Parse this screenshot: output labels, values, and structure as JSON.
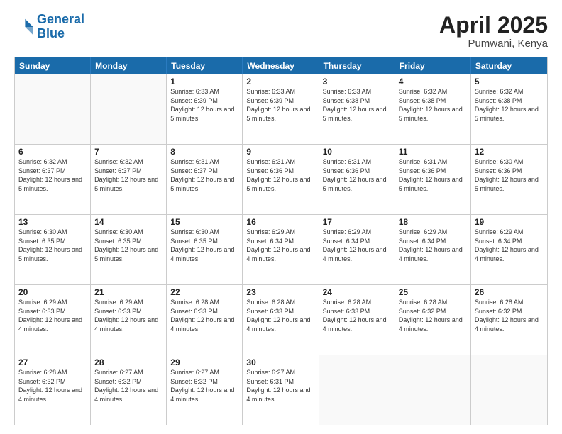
{
  "header": {
    "logo_line1": "General",
    "logo_line2": "Blue",
    "month": "April 2025",
    "location": "Pumwani, Kenya"
  },
  "days_of_week": [
    "Sunday",
    "Monday",
    "Tuesday",
    "Wednesday",
    "Thursday",
    "Friday",
    "Saturday"
  ],
  "weeks": [
    [
      {
        "day": "",
        "info": ""
      },
      {
        "day": "",
        "info": ""
      },
      {
        "day": "1",
        "info": "Sunrise: 6:33 AM\nSunset: 6:39 PM\nDaylight: 12 hours and 5 minutes."
      },
      {
        "day": "2",
        "info": "Sunrise: 6:33 AM\nSunset: 6:39 PM\nDaylight: 12 hours and 5 minutes."
      },
      {
        "day": "3",
        "info": "Sunrise: 6:33 AM\nSunset: 6:38 PM\nDaylight: 12 hours and 5 minutes."
      },
      {
        "day": "4",
        "info": "Sunrise: 6:32 AM\nSunset: 6:38 PM\nDaylight: 12 hours and 5 minutes."
      },
      {
        "day": "5",
        "info": "Sunrise: 6:32 AM\nSunset: 6:38 PM\nDaylight: 12 hours and 5 minutes."
      }
    ],
    [
      {
        "day": "6",
        "info": "Sunrise: 6:32 AM\nSunset: 6:37 PM\nDaylight: 12 hours and 5 minutes."
      },
      {
        "day": "7",
        "info": "Sunrise: 6:32 AM\nSunset: 6:37 PM\nDaylight: 12 hours and 5 minutes."
      },
      {
        "day": "8",
        "info": "Sunrise: 6:31 AM\nSunset: 6:37 PM\nDaylight: 12 hours and 5 minutes."
      },
      {
        "day": "9",
        "info": "Sunrise: 6:31 AM\nSunset: 6:36 PM\nDaylight: 12 hours and 5 minutes."
      },
      {
        "day": "10",
        "info": "Sunrise: 6:31 AM\nSunset: 6:36 PM\nDaylight: 12 hours and 5 minutes."
      },
      {
        "day": "11",
        "info": "Sunrise: 6:31 AM\nSunset: 6:36 PM\nDaylight: 12 hours and 5 minutes."
      },
      {
        "day": "12",
        "info": "Sunrise: 6:30 AM\nSunset: 6:36 PM\nDaylight: 12 hours and 5 minutes."
      }
    ],
    [
      {
        "day": "13",
        "info": "Sunrise: 6:30 AM\nSunset: 6:35 PM\nDaylight: 12 hours and 5 minutes."
      },
      {
        "day": "14",
        "info": "Sunrise: 6:30 AM\nSunset: 6:35 PM\nDaylight: 12 hours and 5 minutes."
      },
      {
        "day": "15",
        "info": "Sunrise: 6:30 AM\nSunset: 6:35 PM\nDaylight: 12 hours and 4 minutes."
      },
      {
        "day": "16",
        "info": "Sunrise: 6:29 AM\nSunset: 6:34 PM\nDaylight: 12 hours and 4 minutes."
      },
      {
        "day": "17",
        "info": "Sunrise: 6:29 AM\nSunset: 6:34 PM\nDaylight: 12 hours and 4 minutes."
      },
      {
        "day": "18",
        "info": "Sunrise: 6:29 AM\nSunset: 6:34 PM\nDaylight: 12 hours and 4 minutes."
      },
      {
        "day": "19",
        "info": "Sunrise: 6:29 AM\nSunset: 6:34 PM\nDaylight: 12 hours and 4 minutes."
      }
    ],
    [
      {
        "day": "20",
        "info": "Sunrise: 6:29 AM\nSunset: 6:33 PM\nDaylight: 12 hours and 4 minutes."
      },
      {
        "day": "21",
        "info": "Sunrise: 6:29 AM\nSunset: 6:33 PM\nDaylight: 12 hours and 4 minutes."
      },
      {
        "day": "22",
        "info": "Sunrise: 6:28 AM\nSunset: 6:33 PM\nDaylight: 12 hours and 4 minutes."
      },
      {
        "day": "23",
        "info": "Sunrise: 6:28 AM\nSunset: 6:33 PM\nDaylight: 12 hours and 4 minutes."
      },
      {
        "day": "24",
        "info": "Sunrise: 6:28 AM\nSunset: 6:33 PM\nDaylight: 12 hours and 4 minutes."
      },
      {
        "day": "25",
        "info": "Sunrise: 6:28 AM\nSunset: 6:32 PM\nDaylight: 12 hours and 4 minutes."
      },
      {
        "day": "26",
        "info": "Sunrise: 6:28 AM\nSunset: 6:32 PM\nDaylight: 12 hours and 4 minutes."
      }
    ],
    [
      {
        "day": "27",
        "info": "Sunrise: 6:28 AM\nSunset: 6:32 PM\nDaylight: 12 hours and 4 minutes."
      },
      {
        "day": "28",
        "info": "Sunrise: 6:27 AM\nSunset: 6:32 PM\nDaylight: 12 hours and 4 minutes."
      },
      {
        "day": "29",
        "info": "Sunrise: 6:27 AM\nSunset: 6:32 PM\nDaylight: 12 hours and 4 minutes."
      },
      {
        "day": "30",
        "info": "Sunrise: 6:27 AM\nSunset: 6:31 PM\nDaylight: 12 hours and 4 minutes."
      },
      {
        "day": "",
        "info": ""
      },
      {
        "day": "",
        "info": ""
      },
      {
        "day": "",
        "info": ""
      }
    ]
  ]
}
